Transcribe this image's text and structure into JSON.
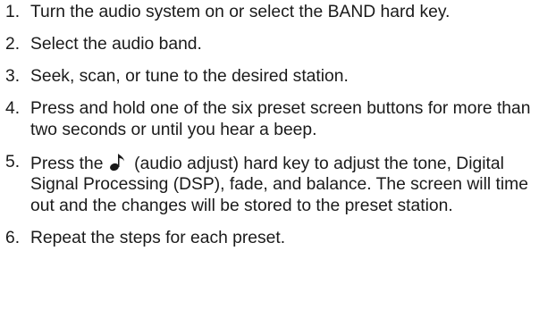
{
  "steps": [
    {
      "number": "1.",
      "text": "Turn the audio system on or select the BAND hard key."
    },
    {
      "number": "2.",
      "text": "Select the audio band."
    },
    {
      "number": "3.",
      "text": "Seek, scan, or tune to the desired station."
    },
    {
      "number": "4.",
      "text": "Press and hold one of the six preset screen buttons for more than two seconds or until you hear a beep."
    },
    {
      "number": "5.",
      "text_before": "Press the ",
      "icon": "music-note-icon",
      "text_after": " (audio adjust) hard key to adjust the tone, Digital Signal Processing (DSP), fade, and balance. The screen will time out and the changes will be stored to the preset station."
    },
    {
      "number": "6.",
      "text": "Repeat the steps for each preset."
    }
  ]
}
